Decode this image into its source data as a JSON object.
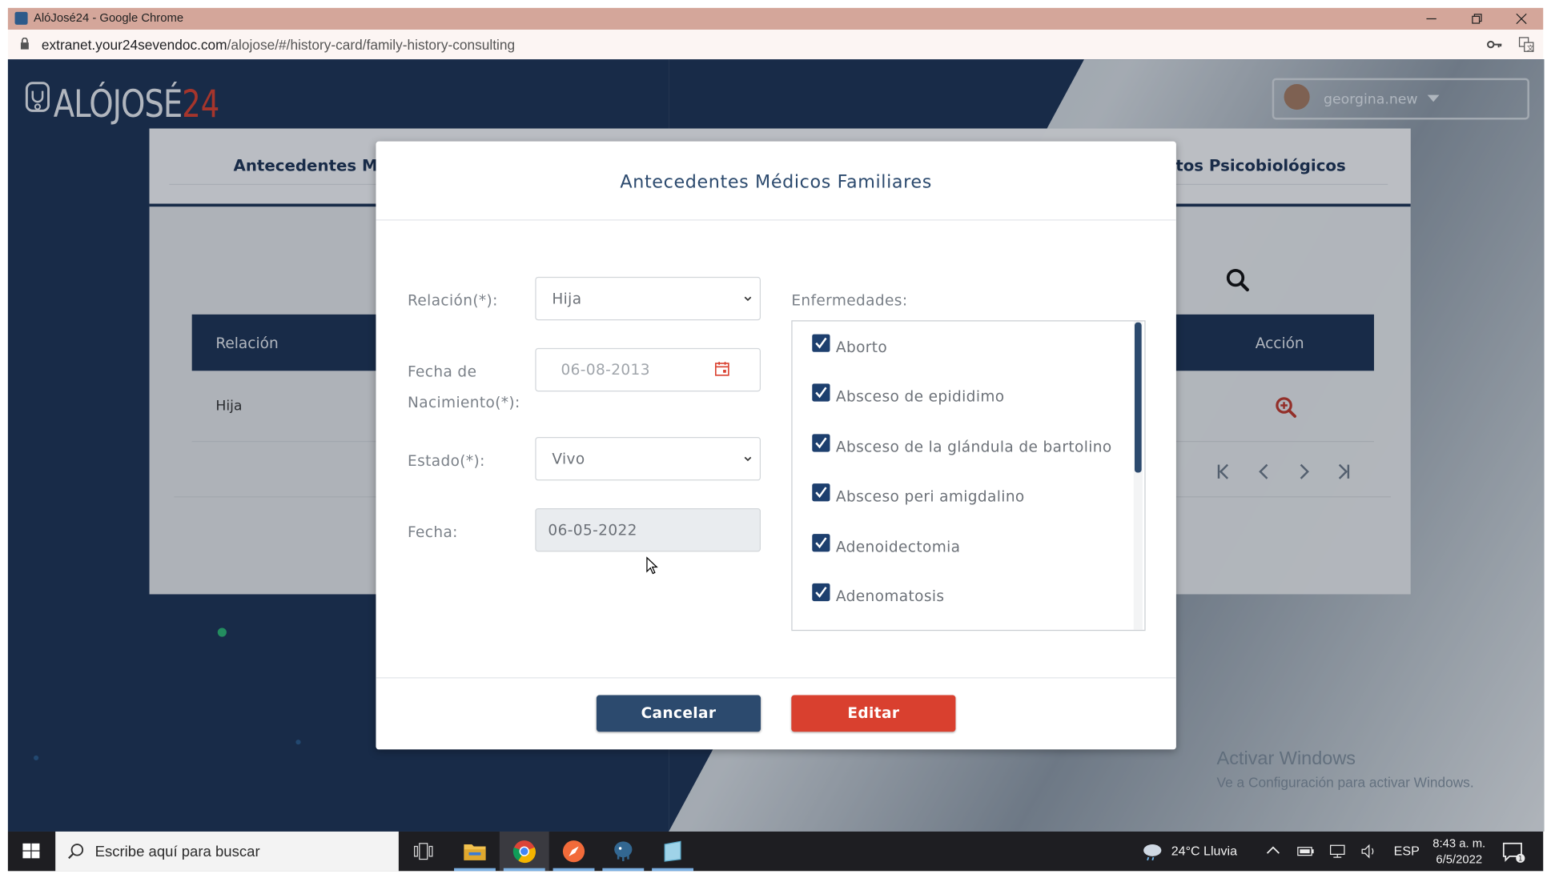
{
  "window": {
    "title": "AlóJosé24 - Google Chrome",
    "minimize_icon": "minimize-icon",
    "restore_icon": "restore-icon",
    "close_icon": "close-icon"
  },
  "address_bar": {
    "domain": "extranet.your24sevendoc.com",
    "path": "/alojose/#/history-card/family-history-consulting"
  },
  "app": {
    "logo_text": "ALÓJOSÉ24",
    "user": {
      "name": "georgina.new"
    },
    "tabs": [
      {
        "label": "Antecedentes Méd"
      },
      {
        "label": "itos Psicobiológicos"
      }
    ],
    "table": {
      "headers": [
        "Relación",
        "Acción"
      ],
      "rows": [
        {
          "relacion": "Hija"
        }
      ]
    }
  },
  "modal": {
    "title": "Antecedentes Médicos Familiares",
    "relacion": {
      "label": "Relación(*):",
      "value": "Hija"
    },
    "fecha_nacimiento": {
      "label_line1": "Fecha de",
      "label_line2": "Nacimiento(*):",
      "value": "06-08-2013"
    },
    "estado": {
      "label": "Estado(*):",
      "value": "Vivo"
    },
    "fecha": {
      "label": "Fecha:",
      "value": "06-05-2022"
    },
    "enfermedades": {
      "label": "Enfermedades:",
      "items": [
        {
          "label": "Aborto",
          "checked": true
        },
        {
          "label": "Absceso de epididimo",
          "checked": true
        },
        {
          "label": "Absceso de la glándula de bartolino",
          "checked": true
        },
        {
          "label": "Absceso peri amigdalino",
          "checked": true
        },
        {
          "label": "Adenoidectomia",
          "checked": true
        },
        {
          "label": "Adenomatosis",
          "checked": true
        }
      ]
    },
    "buttons": {
      "cancel": "Cancelar",
      "edit": "Editar"
    }
  },
  "watermark": {
    "line1": "Activar Windows",
    "line2": "Ve a Configuración para activar Windows."
  },
  "taskbar": {
    "search_placeholder": "Escribe aquí para buscar",
    "weather": "24°C  Lluvia",
    "language": "ESP",
    "time": "8:43 a. m.",
    "date": "6/5/2022",
    "notification_count": "1"
  },
  "colors": {
    "navy": "#1d3354",
    "modal_title": "#2c4a6e",
    "edit_red": "#d9402f",
    "titlebar": "#d4a69a"
  }
}
